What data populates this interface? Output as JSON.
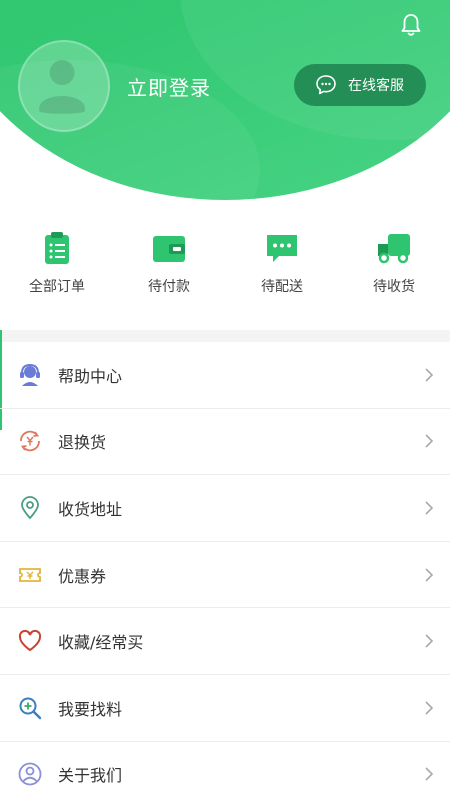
{
  "header": {
    "login_label": "立即登录",
    "service_label": "在线客服",
    "accent_color": "#2fc46f",
    "service_btn_color": "#238e55"
  },
  "orders": [
    {
      "label": "全部订单",
      "icon": "clipboard-list-icon"
    },
    {
      "label": "待付款",
      "icon": "wallet-icon"
    },
    {
      "label": "待配送",
      "icon": "chat-bubble-icon"
    },
    {
      "label": "待收货",
      "icon": "truck-icon"
    }
  ],
  "menu": [
    {
      "label": "帮助中心",
      "icon": "headset-icon"
    },
    {
      "label": "退换货",
      "icon": "yen-exchange-icon"
    },
    {
      "label": "收货地址",
      "icon": "location-pin-icon"
    },
    {
      "label": "优惠券",
      "icon": "coupon-icon"
    },
    {
      "label": "收藏/经常买",
      "icon": "heart-icon"
    },
    {
      "label": "我要找料",
      "icon": "search-plus-icon"
    },
    {
      "label": "关于我们",
      "icon": "user-circle-icon"
    }
  ]
}
